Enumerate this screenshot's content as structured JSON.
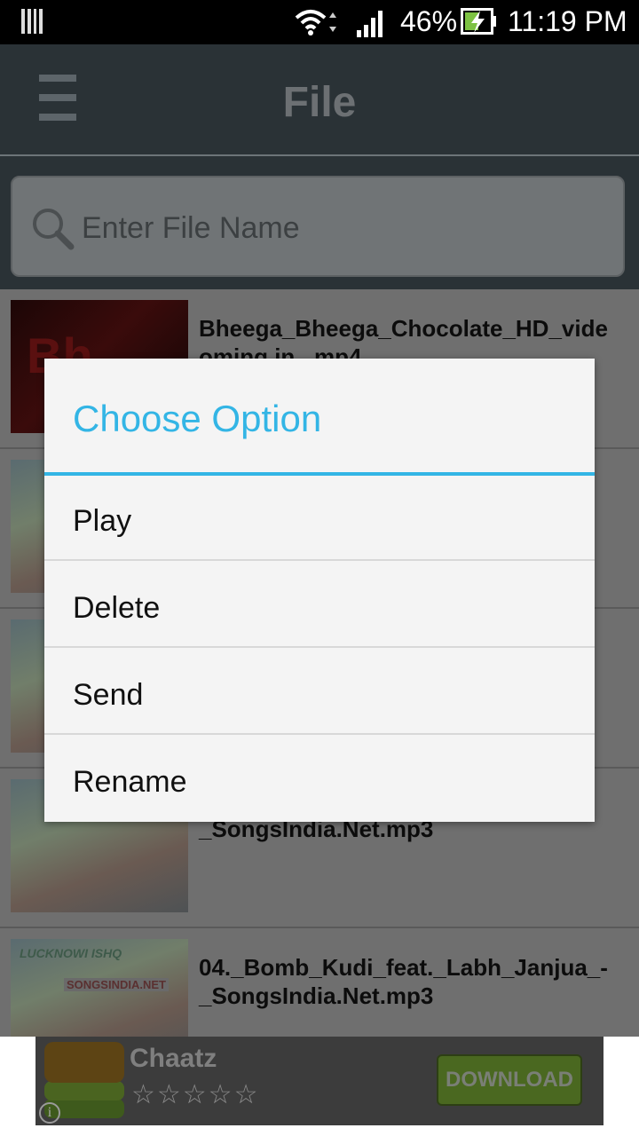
{
  "status_bar": {
    "battery_percent": "46%",
    "time": "11:19 PM",
    "icons": [
      "notification-icon",
      "wifi-icon",
      "signal-icon",
      "battery-charging-icon"
    ]
  },
  "app_bar": {
    "title": "File",
    "menu_icon": "hamburger-menu-icon"
  },
  "search": {
    "placeholder": "Enter File Name",
    "icon": "search-icon"
  },
  "files": [
    {
      "title": "Bheega_Bheega_Chocolate_HD_vide\noming.in_.mp4",
      "thumb": "video"
    },
    {
      "title": "",
      "thumb": "poster"
    },
    {
      "title": "",
      "thumb": "poster"
    },
    {
      "title": "_SongsIndia.Net.mp3",
      "thumb": "poster"
    },
    {
      "title": "04._Bomb_Kudi_feat._Labh_Janjua_-\n_SongsIndia.Net.mp3",
      "thumb": "poster"
    }
  ],
  "thumb_text": {
    "video": "Bh",
    "poster_brand": "LUCKNOWI ISHQ",
    "poster_site": "SONGSINDIA.NET"
  },
  "ad": {
    "name": "Chaatz",
    "stars": "☆☆☆☆☆",
    "button": "DOWNLOAD",
    "info": "i"
  },
  "dialog": {
    "title": "Choose Option",
    "options": [
      "Play",
      "Delete",
      "Send",
      "Rename"
    ]
  },
  "colors": {
    "accent": "#33b5e5",
    "status_bar": "#000000",
    "dim_overlay_list": "#6f6f6f"
  }
}
